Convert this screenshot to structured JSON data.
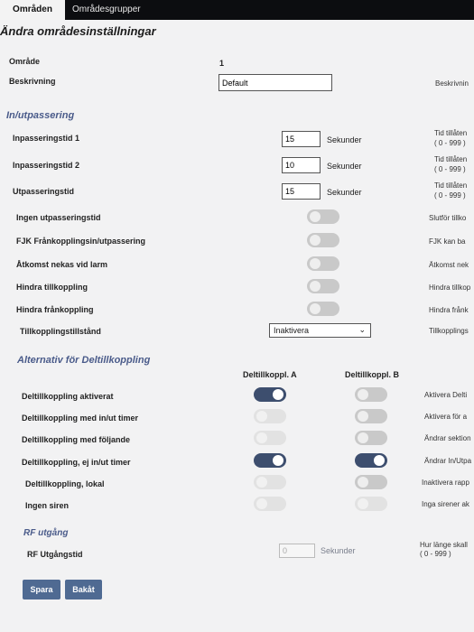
{
  "tabs": [
    {
      "label": "Områden",
      "active": true
    },
    {
      "label": "Områdesgrupper",
      "active": false
    }
  ],
  "page_title": "Ändra områdesinställningar",
  "area": {
    "label": "Område",
    "value": "1"
  },
  "description": {
    "label": "Beskrivning",
    "value": "Default",
    "hint": "Beskrivnin"
  },
  "in_out": {
    "heading": "In/utpassering",
    "entry1": {
      "label": "Inpasseringstid 1",
      "value": "15",
      "unit": "Sekunder",
      "hint1": "Tid tillåten",
      "hint2": "( 0 - 999 )"
    },
    "entry2": {
      "label": "Inpasseringstid 2",
      "value": "10",
      "unit": "Sekunder",
      "hint1": "Tid tillåten",
      "hint2": "( 0 - 999 )"
    },
    "exit": {
      "label": "Utpasseringstid",
      "value": "15",
      "unit": "Sekunder",
      "hint1": "Tid tillåten",
      "hint2": "( 0 - 999 )"
    },
    "toggles": [
      {
        "label": "Ingen utpasseringstid",
        "hint": "Slutför tillko",
        "on": false
      },
      {
        "label": "FJK Frånkopplingsin/utpassering",
        "hint": "FJK kan ba",
        "on": false
      },
      {
        "label": "Åtkomst nekas vid larm",
        "hint": "Åtkomst nek",
        "on": false
      },
      {
        "label": "Hindra tillkoppling",
        "hint": "Hindra tillkop",
        "on": false
      },
      {
        "label": "Hindra frånkoppling",
        "hint": "Hindra frånk",
        "on": false
      }
    ],
    "arm_state": {
      "label": "Tillkopplingstillstånd",
      "value": "Inaktivera",
      "hint": "Tillkopplings"
    }
  },
  "partial": {
    "heading": "Alternativ för Deltillkoppling",
    "col_a": "Deltillkoppl. A",
    "col_b": "Deltillkoppl. B",
    "rows": [
      {
        "label": "Deltillkoppling aktiverat",
        "a_on": true,
        "a_dim": false,
        "b_on": false,
        "b_dim": false,
        "hint": "Aktivera Delti"
      },
      {
        "label": "Deltillkoppling med in/ut timer",
        "a_on": false,
        "a_dim": true,
        "b_on": false,
        "b_dim": false,
        "hint": "Aktivera för a"
      },
      {
        "label": "Deltillkoppling med följande",
        "a_on": false,
        "a_dim": true,
        "b_on": false,
        "b_dim": false,
        "hint": "Ändrar sektion"
      },
      {
        "label": "Deltillkoppling, ej in/ut timer",
        "a_on": true,
        "a_dim": false,
        "b_on": true,
        "b_dim": false,
        "hint": "Ändrar In/Utpa"
      },
      {
        "label": "Deltillkoppling, lokal",
        "a_on": false,
        "a_dim": true,
        "b_on": false,
        "b_dim": false,
        "hint": "Inaktivera rapp"
      },
      {
        "label": "Ingen siren",
        "a_on": false,
        "a_dim": true,
        "b_on": false,
        "b_dim": true,
        "hint": "Inga sirener ak"
      }
    ]
  },
  "rf": {
    "heading": "RF utgång",
    "label": "RF Utgångstid",
    "value": "0",
    "unit": "Sekunder",
    "hint1": "Hur länge skall",
    "hint2": "( 0 - 999 )"
  },
  "buttons": {
    "save": "Spara",
    "back": "Bakåt"
  }
}
